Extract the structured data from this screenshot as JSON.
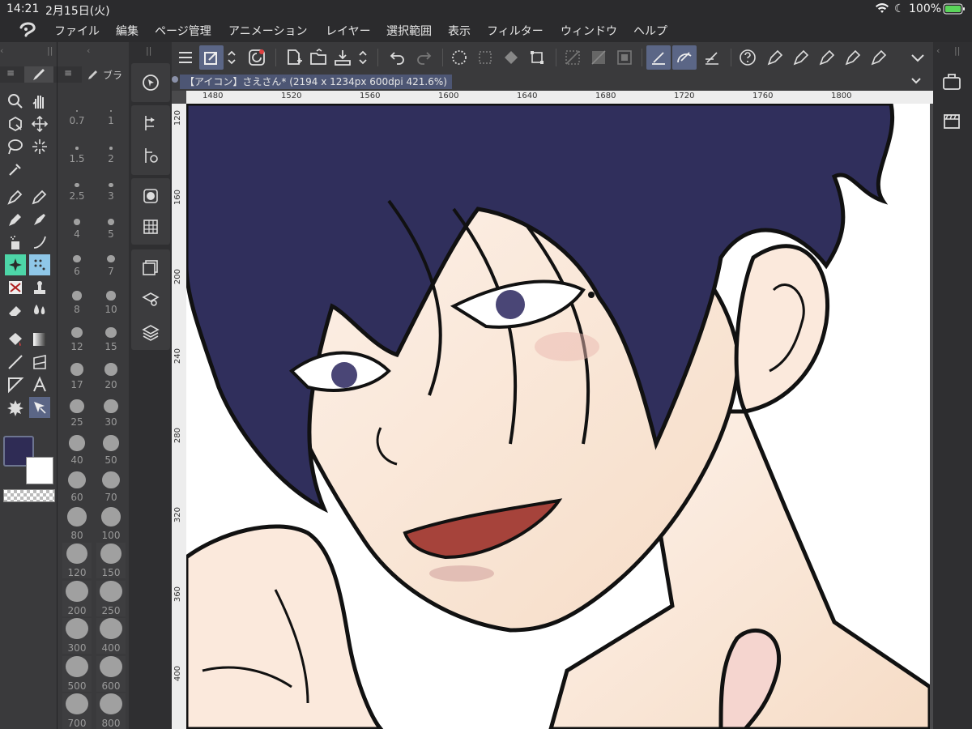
{
  "status": {
    "time": "14:21",
    "date": "2月15日(火)",
    "battery": "100%"
  },
  "menu": {
    "items": [
      "ファイル",
      "編集",
      "ページ管理",
      "アニメーション",
      "レイヤー",
      "選択範囲",
      "表示",
      "フィルター",
      "ウィンドウ",
      "ヘルプ"
    ]
  },
  "left_tabs": {
    "tool_prop_tab": "ブラ"
  },
  "document": {
    "title": "【アイコン】さえさん* (2194 x 1234px 600dpi 421.6%)"
  },
  "ruler": {
    "top": [
      "1480",
      "1520",
      "1560",
      "1600",
      "1640",
      "1680",
      "1720",
      "1760",
      "1800"
    ],
    "left": [
      "120",
      "160",
      "200",
      "240",
      "280",
      "320",
      "360",
      "400"
    ]
  },
  "brush_sizes": [
    "0.7",
    "1",
    "1.5",
    "2",
    "2.5",
    "3",
    "4",
    "5",
    "6",
    "7",
    "8",
    "10",
    "12",
    "15",
    "17",
    "20",
    "25",
    "30",
    "40",
    "50",
    "60",
    "70",
    "80",
    "100",
    "120",
    "150",
    "200",
    "250",
    "300",
    "400",
    "500",
    "600",
    "700",
    "800"
  ],
  "colors": {
    "main": "#2f2c55",
    "sub": "#ffffff",
    "accent": "#5b6686",
    "hair": "#302f5c",
    "skin": "#fbe9dc"
  },
  "icons": {
    "toolbar": [
      "menu-icon",
      "quick-access-icon",
      "spin-icon",
      "undo-history-icon",
      "new-file-icon",
      "open-icon",
      "save-icon",
      "spin-icon",
      "undo-icon",
      "redo-icon",
      "select-icon",
      "clear-select-icon",
      "fill-icon",
      "transform-icon",
      "hide-select-icon",
      "snap-icon",
      "ruler-icon",
      "pen-pressure-icon",
      "brush-icon",
      "angle-icon",
      "help-icon",
      "pen1-icon",
      "pen2-icon",
      "pen3-icon",
      "pen4-icon",
      "pen5-icon",
      "collapse-icon"
    ]
  }
}
